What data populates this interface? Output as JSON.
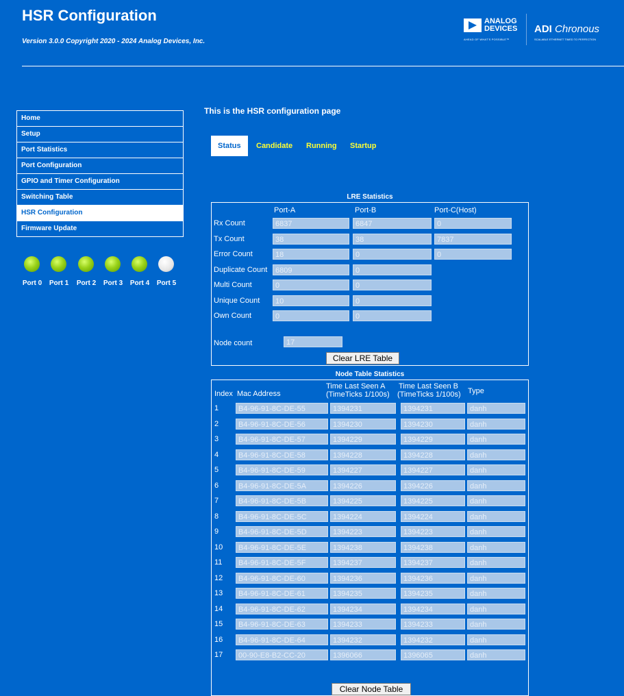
{
  "header": {
    "title": "HSR Configuration",
    "version": "Version 3.0.0 Copyright 2020 - 2024 Analog Devices, Inc.",
    "logo_brand_line1": "ANALOG",
    "logo_brand_line2": "DEVICES",
    "logo_tagline": "AHEAD OF WHAT'S POSSIBLE™",
    "chronous_bold": "ADI",
    "chronous_italic": "Chronous",
    "chronous_tagline": "SCALABLE ETHERNET TIMED TO PERFECTION"
  },
  "nav": {
    "items": [
      "Home",
      "Setup",
      "Port Statistics",
      "Port Configuration",
      "GPIO and Timer Configuration",
      "Switching Table",
      "HSR Configuration",
      "Firmware Update"
    ],
    "active_index": 6
  },
  "ports": {
    "labels": [
      "Port 0",
      "Port 1",
      "Port 2",
      "Port 3",
      "Port 4",
      "Port 5"
    ],
    "states": [
      "on",
      "on",
      "on",
      "on",
      "on",
      "off"
    ]
  },
  "page": {
    "heading": "This is the HSR configuration page"
  },
  "tabs": {
    "items": [
      "Status",
      "Candidate",
      "Running",
      "Startup"
    ],
    "active_index": 0
  },
  "lre": {
    "title": "LRE Statistics",
    "col_a": "Port-A",
    "col_b": "Port-B",
    "col_c": "Port-C(Host)",
    "rows": [
      {
        "label": "Rx Count",
        "a": "6837",
        "b": "6847",
        "c": "0"
      },
      {
        "label": "Tx Count",
        "a": "38",
        "b": "38",
        "c": "7837"
      },
      {
        "label": "Error Count",
        "a": "18",
        "b": "0",
        "c": "0"
      },
      {
        "label": "Duplicate Count",
        "a": "6809",
        "b": "0",
        "c": null
      },
      {
        "label": "Multi Count",
        "a": "0",
        "b": "0",
        "c": null
      },
      {
        "label": "Unique Count",
        "a": "10",
        "b": "0",
        "c": null
      },
      {
        "label": "Own Count",
        "a": "0",
        "b": "0",
        "c": null
      }
    ],
    "node_count_label": "Node count",
    "node_count": "17",
    "clear_button": "Clear LRE Table"
  },
  "node_table": {
    "title": "Node Table Statistics",
    "col_index": "Index",
    "col_mac": "Mac Address",
    "col_time_a_1": "Time Last Seen A",
    "col_time_a_2": "(TimeTicks 1/100s)",
    "col_time_b_1": "Time Last Seen B",
    "col_time_b_2": "(TimeTicks 1/100s)",
    "col_type": "Type",
    "rows": [
      {
        "index": "1",
        "mac": "B4-96-91-8C-DE-55",
        "time_a": "1394231",
        "time_b": "1394231",
        "type": "danh"
      },
      {
        "index": "2",
        "mac": "B4-96-91-8C-DE-56",
        "time_a": "1394230",
        "time_b": "1394230",
        "type": "danh"
      },
      {
        "index": "3",
        "mac": "B4-96-91-8C-DE-57",
        "time_a": "1394229",
        "time_b": "1394229",
        "type": "danh"
      },
      {
        "index": "4",
        "mac": "B4-96-91-8C-DE-58",
        "time_a": "1394228",
        "time_b": "1394228",
        "type": "danh"
      },
      {
        "index": "5",
        "mac": "B4-96-91-8C-DE-59",
        "time_a": "1394227",
        "time_b": "1394227",
        "type": "danh"
      },
      {
        "index": "6",
        "mac": "B4-96-91-8C-DE-5A",
        "time_a": "1394226",
        "time_b": "1394226",
        "type": "danh"
      },
      {
        "index": "7",
        "mac": "B4-96-91-8C-DE-5B",
        "time_a": "1394225",
        "time_b": "1394225",
        "type": "danh"
      },
      {
        "index": "8",
        "mac": "B4-96-91-8C-DE-5C",
        "time_a": "1394224",
        "time_b": "1394224",
        "type": "danh"
      },
      {
        "index": "9",
        "mac": "B4-96-91-8C-DE-5D",
        "time_a": "1394223",
        "time_b": "1394223",
        "type": "danh"
      },
      {
        "index": "10",
        "mac": "B4-96-91-8C-DE-5E",
        "time_a": "1394238",
        "time_b": "1394238",
        "type": "danh"
      },
      {
        "index": "11",
        "mac": "B4-96-91-8C-DE-5F",
        "time_a": "1394237",
        "time_b": "1394237",
        "type": "danh"
      },
      {
        "index": "12",
        "mac": "B4-96-91-8C-DE-60",
        "time_a": "1394236",
        "time_b": "1394236",
        "type": "danh"
      },
      {
        "index": "13",
        "mac": "B4-96-91-8C-DE-61",
        "time_a": "1394235",
        "time_b": "1394235",
        "type": "danh"
      },
      {
        "index": "14",
        "mac": "B4-96-91-8C-DE-62",
        "time_a": "1394234",
        "time_b": "1394234",
        "type": "danh"
      },
      {
        "index": "15",
        "mac": "B4-96-91-8C-DE-63",
        "time_a": "1394233",
        "time_b": "1394233",
        "type": "danh"
      },
      {
        "index": "16",
        "mac": "B4-96-91-8C-DE-64",
        "time_a": "1394232",
        "time_b": "1394232",
        "type": "danh"
      },
      {
        "index": "17",
        "mac": "00-90-E8-B2-CC-20",
        "time_a": "1396066",
        "time_b": "1396065",
        "type": "danh"
      }
    ],
    "clear_button": "Clear Node Table"
  },
  "colors": {
    "background": "#0066cc",
    "inactive_tab": "#ffff33",
    "field_bg": "#a9c7e8",
    "led_on": "#9ad21a",
    "led_off": "#e6e6e6"
  }
}
